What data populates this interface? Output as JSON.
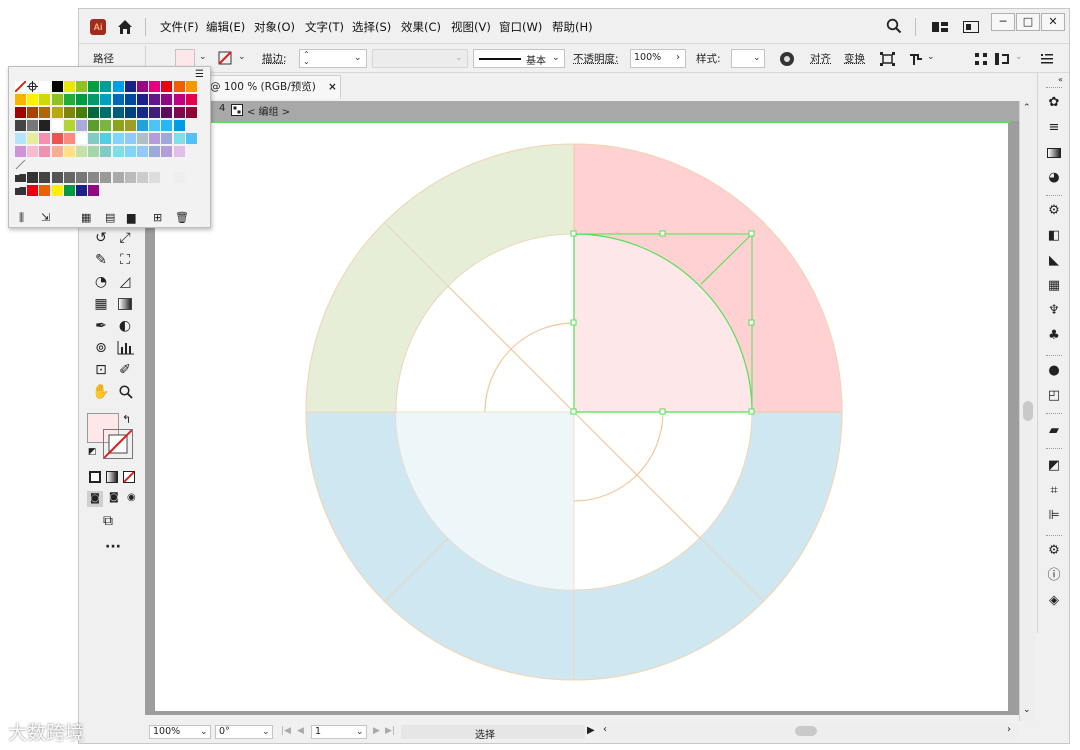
{
  "menubar": {
    "app_logo": "Ai",
    "items": [
      "文件(F)",
      "编辑(E)",
      "对象(O)",
      "文字(T)",
      "选择(S)",
      "效果(C)",
      "视图(V)",
      "窗口(W)",
      "帮助(H)"
    ],
    "window_buttons": [
      "─",
      "□",
      "✕"
    ]
  },
  "controlbar": {
    "selection_type": "路径",
    "stroke_label": "描边:",
    "stroke_profile": "基本",
    "opacity_label": "不透明度:",
    "opacity_value": "100%",
    "style_label": "样式:",
    "align_label": "对齐",
    "transform_label": "变换"
  },
  "document": {
    "tab_title": "@ 100 % (RGB/预览)",
    "tab_close": "×",
    "breadcrumb_num": "4",
    "breadcrumb_label": "< 编组 >"
  },
  "statusbar": {
    "zoom": "100%",
    "rotation": "0°",
    "artboard_index": "1",
    "mode": "选择"
  },
  "colors": {
    "accent_selection": "#55e155",
    "fill_swatch": "#fde7e8",
    "wheel_green": "#e6eed8",
    "wheel_red": "#ffd1d3",
    "wheel_blue": "#cfe7f1",
    "wheel_stroke": "#f3c89b"
  },
  "watermark": "大数跨境",
  "icons": {
    "home": "home-icon",
    "search": "search-icon",
    "workspace": "workspace-icon",
    "arrange": "arrange-documents-icon"
  }
}
